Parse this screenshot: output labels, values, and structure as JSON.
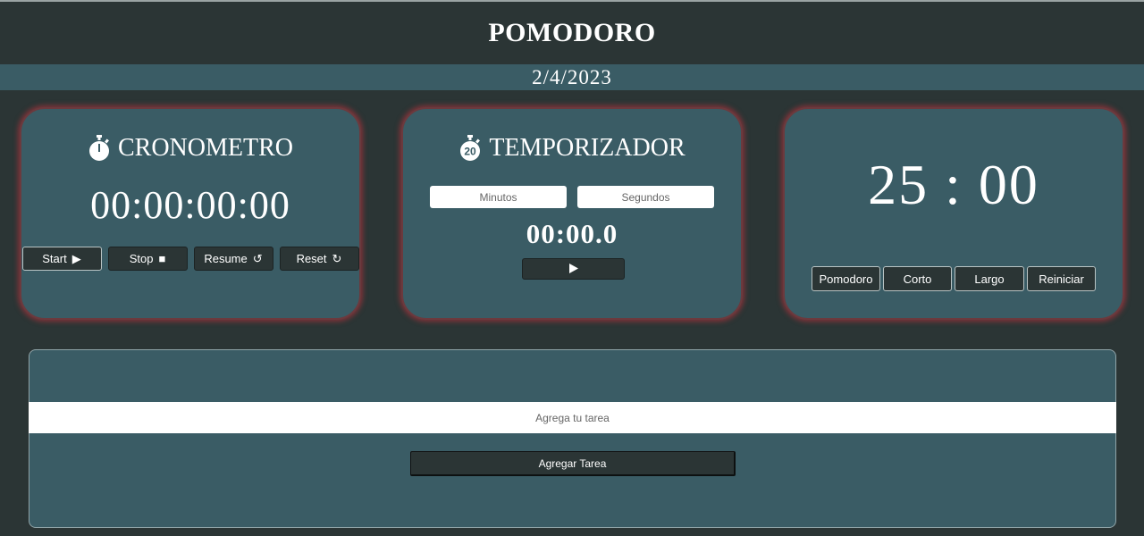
{
  "app": {
    "title": "POMODORO",
    "date": "2/4/2023"
  },
  "cronometro": {
    "title": "CRONOMETRO",
    "icon": "stopwatch-icon",
    "display": "00:00:00:00",
    "buttons": [
      {
        "label": "Start",
        "glyph": "▶"
      },
      {
        "label": "Stop",
        "glyph": "■"
      },
      {
        "label": "Resume",
        "glyph": "↺"
      },
      {
        "label": "Reset",
        "glyph": "↻"
      }
    ]
  },
  "temporizador": {
    "title": "TEMPORIZADOR",
    "icon": "timer-20-icon",
    "icon_text": "20",
    "minutes_placeholder": "Minutos",
    "seconds_placeholder": "Segundos",
    "display": "00:00.0",
    "play_icon": "play-icon"
  },
  "pomodoro": {
    "display": "25 : 00",
    "buttons": [
      "Pomodoro",
      "Corto",
      "Largo",
      "Reiniciar"
    ]
  },
  "tasks": {
    "input_placeholder": "Agrega tu tarea",
    "add_button": "Agregar Tarea"
  },
  "colors": {
    "background": "#2b3535",
    "panel": "#3a5c65",
    "card_glow": "#c8323c",
    "text": "#ffffff"
  }
}
